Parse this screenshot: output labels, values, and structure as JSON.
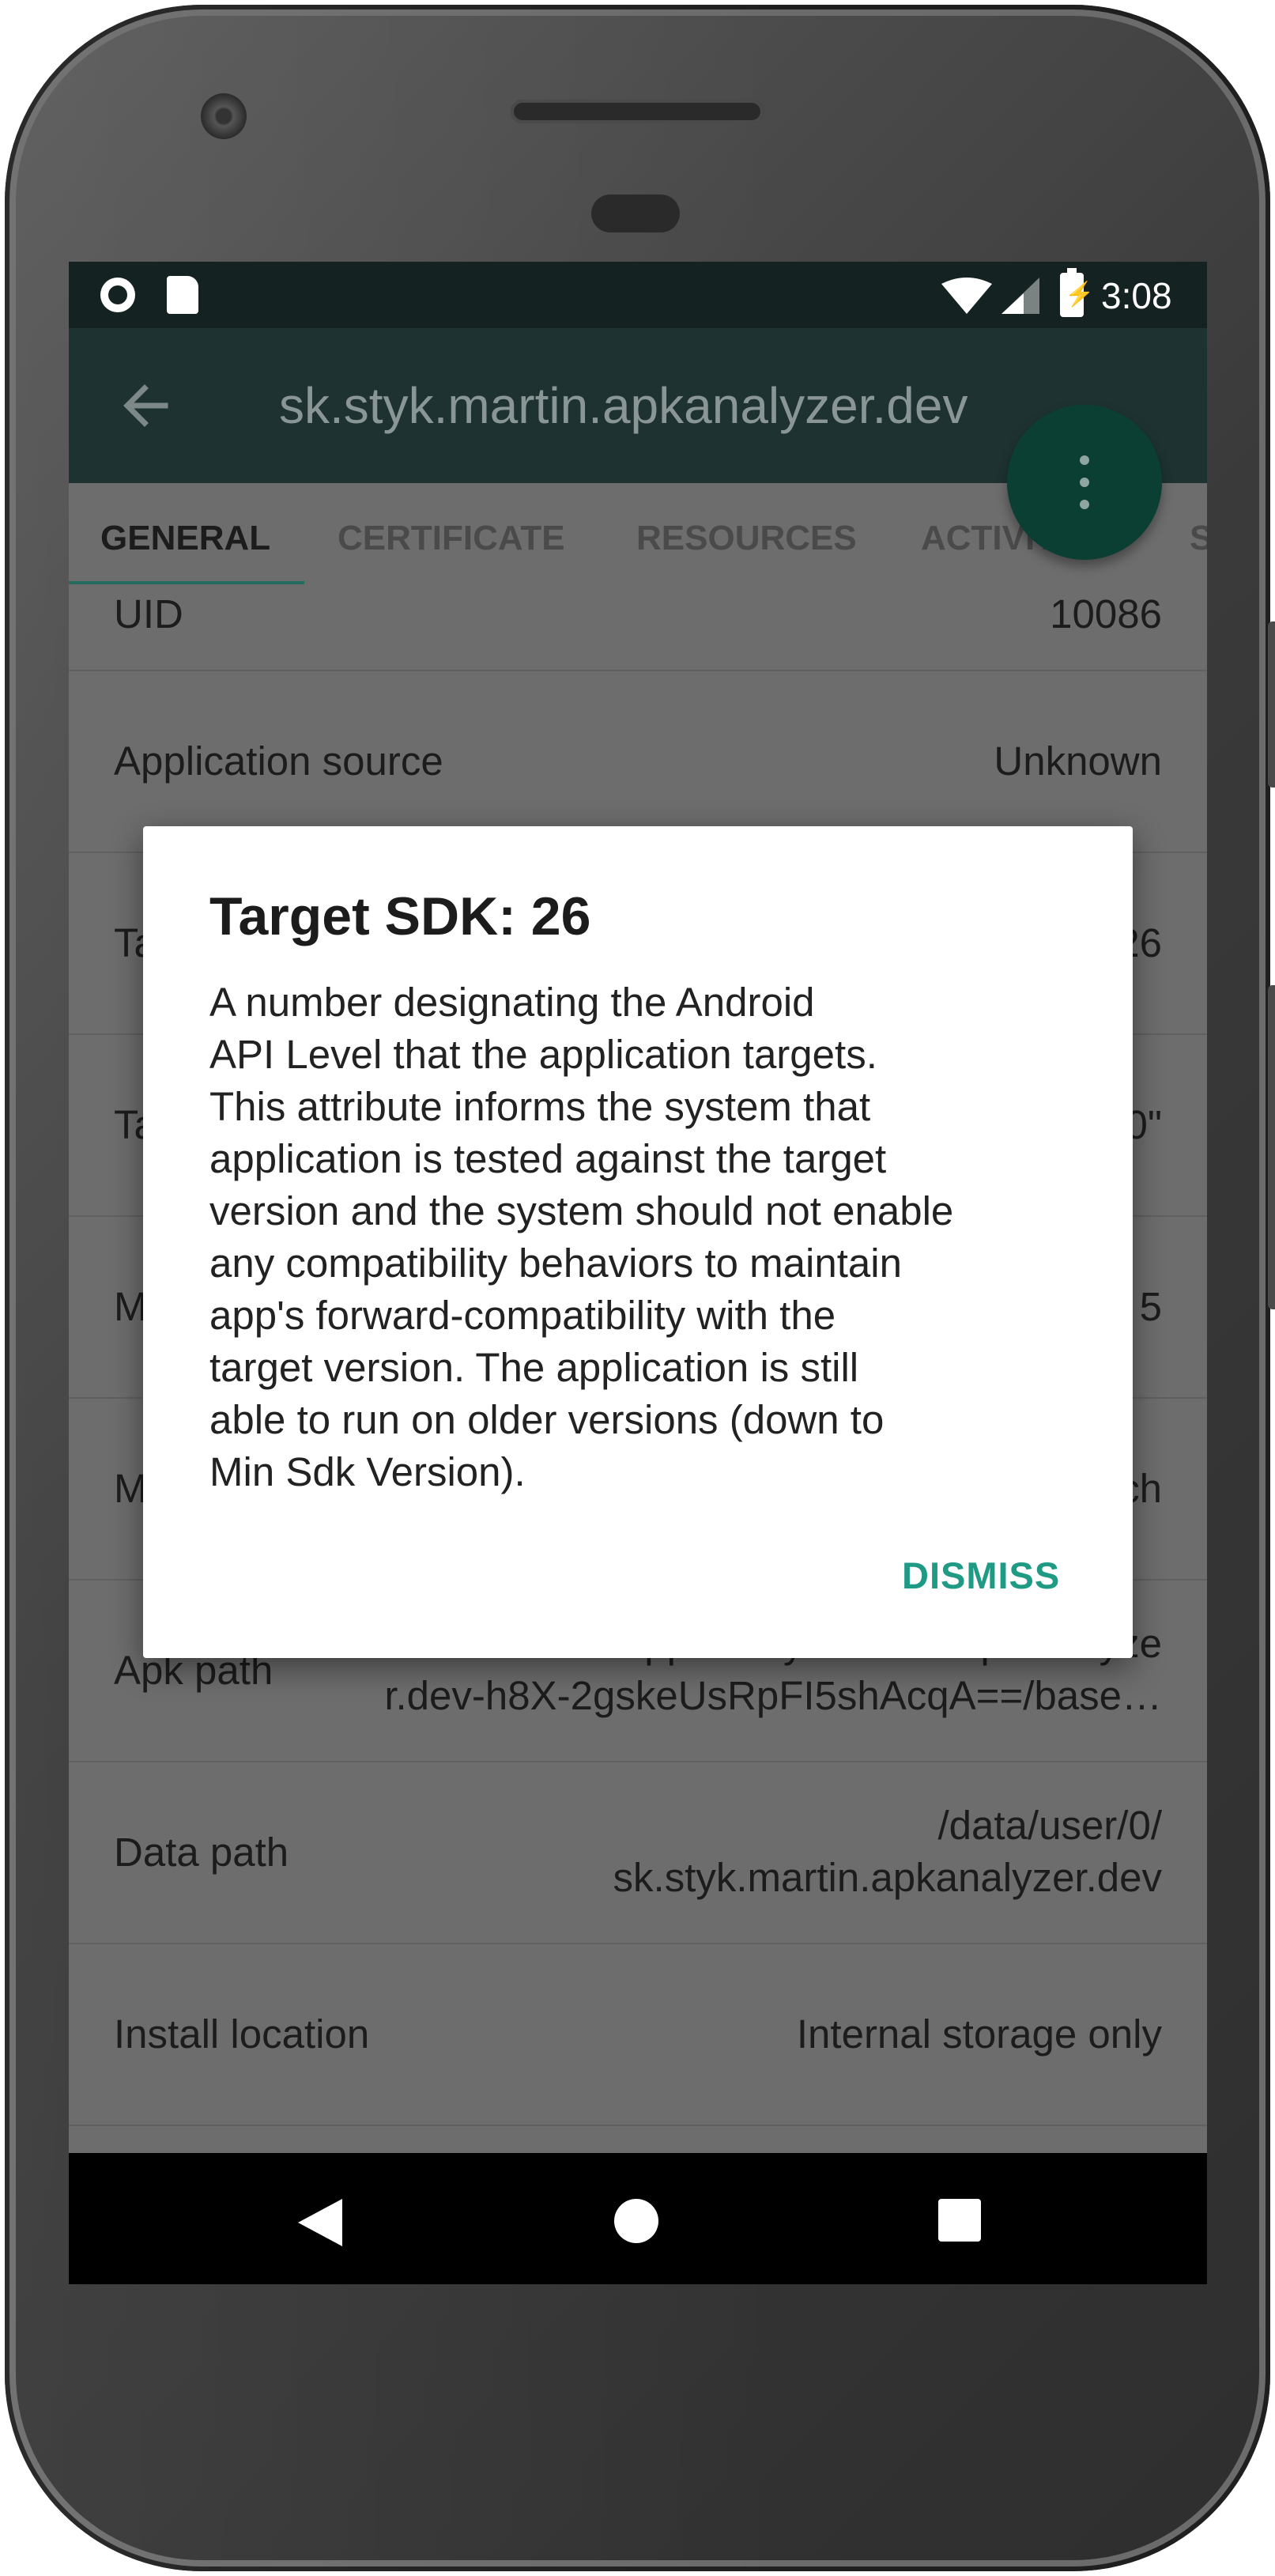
{
  "status_bar": {
    "time": "3:08",
    "icons": [
      "record-icon",
      "sd-card-icon",
      "wifi-icon",
      "signal-icon",
      "battery-charging-icon"
    ]
  },
  "app_bar": {
    "back_icon": "arrow-back-icon",
    "title": "sk.styk.martin.apkanalyzer.dev",
    "fab_icon": "more-vertical-icon"
  },
  "tabs": [
    {
      "label": "GENERAL",
      "active": true
    },
    {
      "label": "CERTIFICATE",
      "active": false
    },
    {
      "label": "RESOURCES",
      "active": false
    },
    {
      "label": "ACTIVITIES",
      "active": false
    },
    {
      "label": "S",
      "active": false
    }
  ],
  "rows": [
    {
      "label": "UID",
      "value": "10086"
    },
    {
      "label": "Application source",
      "value": "Unknown"
    },
    {
      "label": "Ta",
      "value": "26"
    },
    {
      "label": "Ta",
      "value": "0\""
    },
    {
      "label": "M",
      "value": "5"
    },
    {
      "label": "M",
      "value": "ch"
    },
    {
      "label": "Apk path",
      "value_line1": "/data/app/sk.styk.martin.apkanalyze",
      "value_line2": "r.dev-h8X-2gskeUsRpFI5shAcqA==/base…"
    },
    {
      "label": "Data path",
      "value_line1": "/data/user/0/",
      "value_line2": "sk.styk.martin.apkanalyzer.dev"
    },
    {
      "label": "Install location",
      "value": "Internal storage only"
    }
  ],
  "dialog": {
    "title": "Target SDK: 26",
    "body_lines": [
      "A number designating the Android",
      "API Level that the application targets.",
      "This attribute informs the system that",
      "application is tested against the target",
      "version and the system should not enable",
      "any compatibility behaviors to maintain",
      "app's forward-compatibility with the",
      "target version. The application is still",
      "able to run on older versions (down to",
      "Min Sdk Version)."
    ],
    "dismiss_label": "DISMISS"
  },
  "nav_bar": {
    "icons": [
      "nav-back-icon",
      "nav-home-icon",
      "nav-recents-icon"
    ]
  },
  "colors": {
    "accent": "#1f9a84",
    "fab": "#0b3f33",
    "app_bar": "#1e3232",
    "status_bar": "#142222",
    "scrim_content": "#6d6d6d"
  }
}
